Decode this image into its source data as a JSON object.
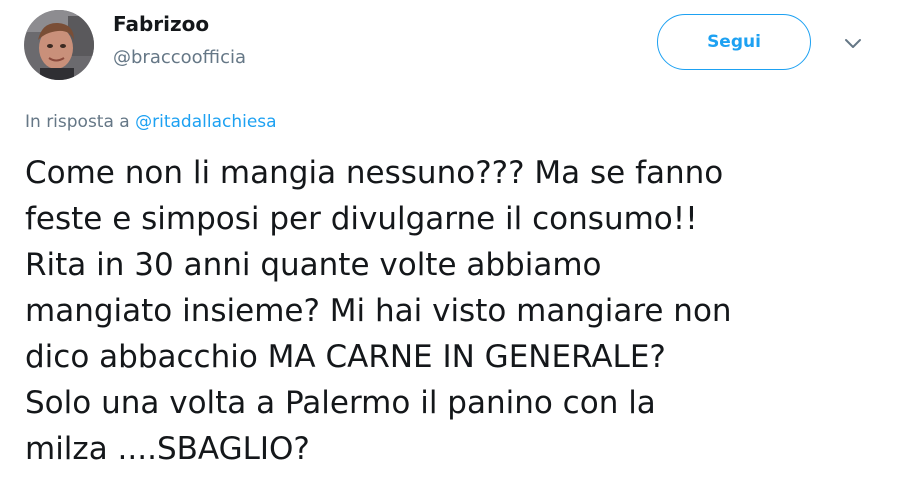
{
  "author": {
    "display_name": "Fabrizoo",
    "handle": "@braccoofficia"
  },
  "actions": {
    "follow_label": "Segui",
    "menu_icon": "chevron-down-icon"
  },
  "reply": {
    "prefix": "In risposta a",
    "mention": "@ritadallachiesa"
  },
  "tweet": {
    "lines": [
      "Come non li mangia nessuno??? Ma se fanno",
      "feste e simposi per divulgarne il consumo!!",
      "Rita in 30 anni quante volte abbiamo",
      "mangiato insieme? Mi hai visto mangiare non",
      "dico abbacchio MA CARNE IN GENERALE?",
      "Solo una volta a Palermo il panino con la",
      "milza ....SBAGLIO?"
    ]
  },
  "colors": {
    "accent": "#1da1f2",
    "text": "#14171a",
    "muted": "#657786"
  }
}
